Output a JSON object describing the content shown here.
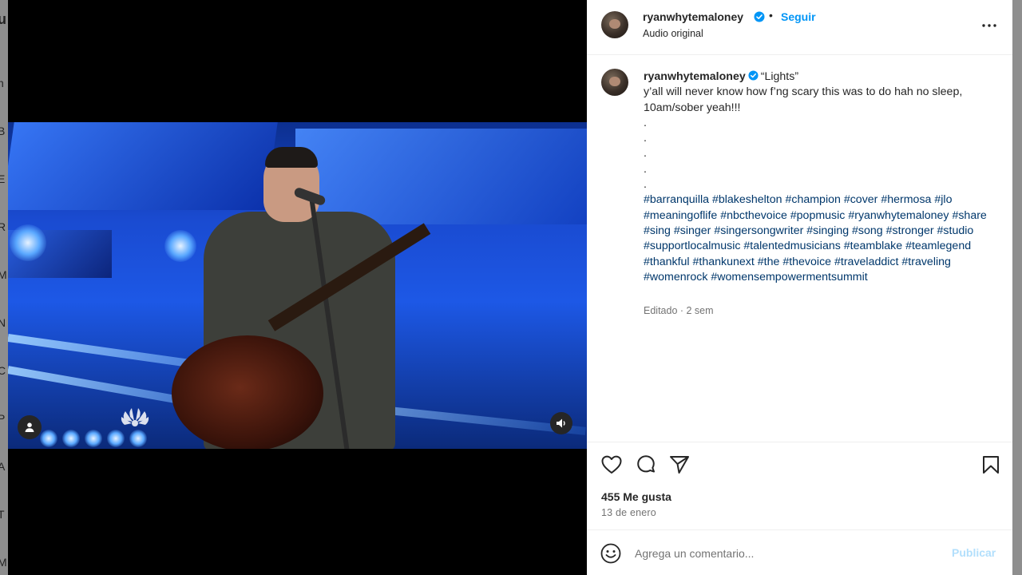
{
  "backdrop": {
    "letters": [
      "u",
      "n",
      "B",
      "E",
      "R",
      "M",
      "N",
      "C",
      "P",
      "A",
      "T",
      "M"
    ]
  },
  "post": {
    "username": "ryanwhytemaloney",
    "separator_dot": "•",
    "follow_label": "Seguir",
    "audio_label": "Audio original",
    "caption": {
      "username": "ryanwhytemaloney",
      "title": "“Lights”",
      "text": "y’all will never know how f’ng scary this was to do hah no sleep, 10am/sober yeah!!!",
      "dots": [
        ".",
        ".",
        ".",
        ".",
        "."
      ],
      "hashtags": "#barranquilla #blakeshelton #champion #cover #hermosa #jlo #meaningoflife #nbcthevoice #popmusic #ryanwhytemaloney #share #sing #singer #singersongwriter #singing #song #stronger #studio #supportlocalmusic #talentedmusicians #teamblake #teamlegend #thankful #thankunext #the #thevoice #traveladdict #traveling #womenrock #womensempowermentsummit"
    },
    "meta": "Editado · 2 sem",
    "likes": "455 Me gusta",
    "date": "13 de enero"
  },
  "comment": {
    "placeholder": "Agrega un comentario...",
    "publish_label": "Publicar"
  },
  "icons": {
    "verified": "verified-badge-icon",
    "more": "more-options-icon",
    "like": "heart-icon",
    "comment": "comment-icon",
    "share": "send-icon",
    "save": "bookmark-icon",
    "emoji": "emoji-icon",
    "user_tag": "user-tag-icon",
    "volume": "volume-icon"
  },
  "colors": {
    "link_blue": "#0095f6",
    "hashtag_blue": "#00376b",
    "verified_blue": "#0095f6",
    "muted_text": "#737373",
    "publish_disabled": "#b2dffc"
  }
}
